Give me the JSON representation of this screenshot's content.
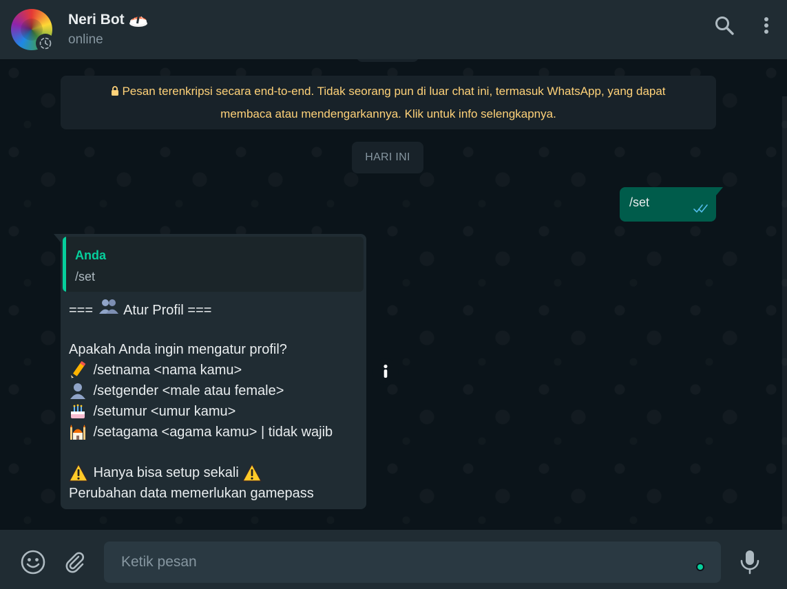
{
  "header": {
    "name": "Neri Bot",
    "name_emoji": "sushi-icon",
    "status": "online",
    "actions": [
      "search-icon",
      "menu-dots-icon"
    ]
  },
  "chat": {
    "encryption_notice": {
      "line1": "Pesan terenkripsi secara end-to-end. Tidak seorang pun di luar chat ini, termasuk WhatsApp, yang dapat",
      "line2": "membaca atau mendengarkannya. Klik untuk info selengkapnya."
    },
    "date_chip": "HARI INI",
    "outgoing": {
      "text": "/set",
      "status": "read"
    },
    "incoming": {
      "quote_author": "Anda",
      "quote_text": "/set",
      "lines": [
        {
          "emoji": "",
          "text": "=== 👥 Atur Profil ==="
        },
        {
          "spacer": true
        },
        {
          "emoji": "",
          "text": "Apakah Anda ingin mengatur profil?"
        },
        {
          "emoji": "pencil",
          "text": "/setnama <nama kamu>"
        },
        {
          "emoji": "person",
          "text": "/setgender <male atau female>"
        },
        {
          "emoji": "cake",
          "text": "/setumur <umur kamu>"
        },
        {
          "emoji": "mosque",
          "text": "/setagama <agama kamu> | tidak wajib"
        },
        {
          "spacer": true
        },
        {
          "emoji": "warning",
          "text": "Hanya bisa setup sekali",
          "emoji_after": "warning"
        },
        {
          "emoji": "",
          "text": "Perubahan data memerlukan gamepass"
        }
      ]
    }
  },
  "footer": {
    "placeholder": "Ketik pesan"
  },
  "colors": {
    "header_bg": "#202c33",
    "chat_bg": "#0b141a",
    "outgoing_bg": "#005c4b",
    "incoming_bg": "#202c33",
    "accent": "#06cf9c",
    "notice_text": "#ffd279"
  }
}
